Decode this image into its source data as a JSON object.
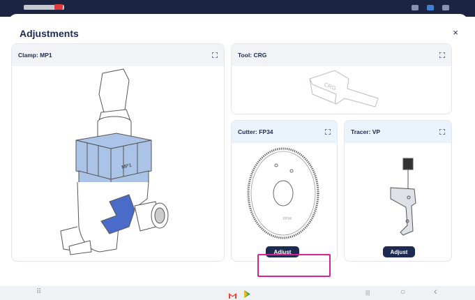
{
  "modal": {
    "title": "Adjustments",
    "close_glyph": "×"
  },
  "panels": {
    "clamp": {
      "title": "Clamp: MP1",
      "label": "MP1"
    },
    "tool": {
      "title": "Tool: CRG",
      "label": "CRG"
    },
    "cutter": {
      "title": "Cutter: FP34",
      "button": "Adjust"
    },
    "tracer": {
      "title": "Tracer: VP",
      "button": "Adjust"
    }
  },
  "navbar": {
    "apps_glyph": "⠿",
    "recents_glyph": "|||",
    "home_glyph": "○",
    "back_glyph": "‹"
  },
  "colors": {
    "accent": "#1d2a52",
    "highlight": "#d8248a",
    "header_blue": "#eaf3fb",
    "clamp_blue": "#aac3e6",
    "arm_blue": "#4a6cc8"
  },
  "icons": [
    "expand-icon",
    "close-icon",
    "gmail-icon",
    "play-store-icon"
  ]
}
